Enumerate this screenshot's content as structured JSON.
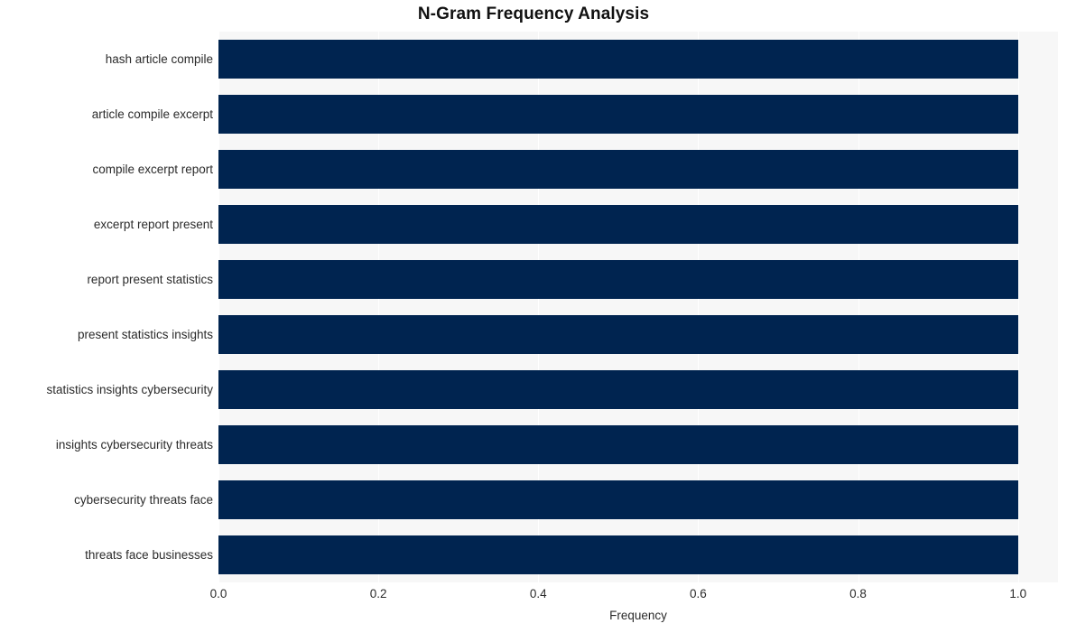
{
  "chart_data": {
    "type": "bar",
    "orientation": "horizontal",
    "title": "N-Gram Frequency Analysis",
    "xlabel": "Frequency",
    "ylabel": "",
    "categories": [
      "hash article compile",
      "article compile excerpt",
      "compile excerpt report",
      "excerpt report present",
      "report present statistics",
      "present statistics insights",
      "statistics insights cybersecurity",
      "insights cybersecurity threats",
      "cybersecurity threats face",
      "threats face businesses"
    ],
    "values": [
      1.0,
      1.0,
      1.0,
      1.0,
      1.0,
      1.0,
      1.0,
      1.0,
      1.0,
      1.0
    ],
    "xlim": [
      0.0,
      1.05
    ],
    "xticks": [
      0.0,
      0.2,
      0.4,
      0.6,
      0.8,
      1.0
    ],
    "xticklabels": [
      "0.0",
      "0.2",
      "0.4",
      "0.6",
      "0.8",
      "1.0"
    ],
    "grid": true,
    "grid_axis": "x",
    "legend": null,
    "bar_color": "#002450",
    "plot_background": "#f7f7f7",
    "figure_background": "#ffffff",
    "gridline_color": "#ffffff",
    "text_color": "#2b2b2b",
    "title_color": "#111111"
  }
}
